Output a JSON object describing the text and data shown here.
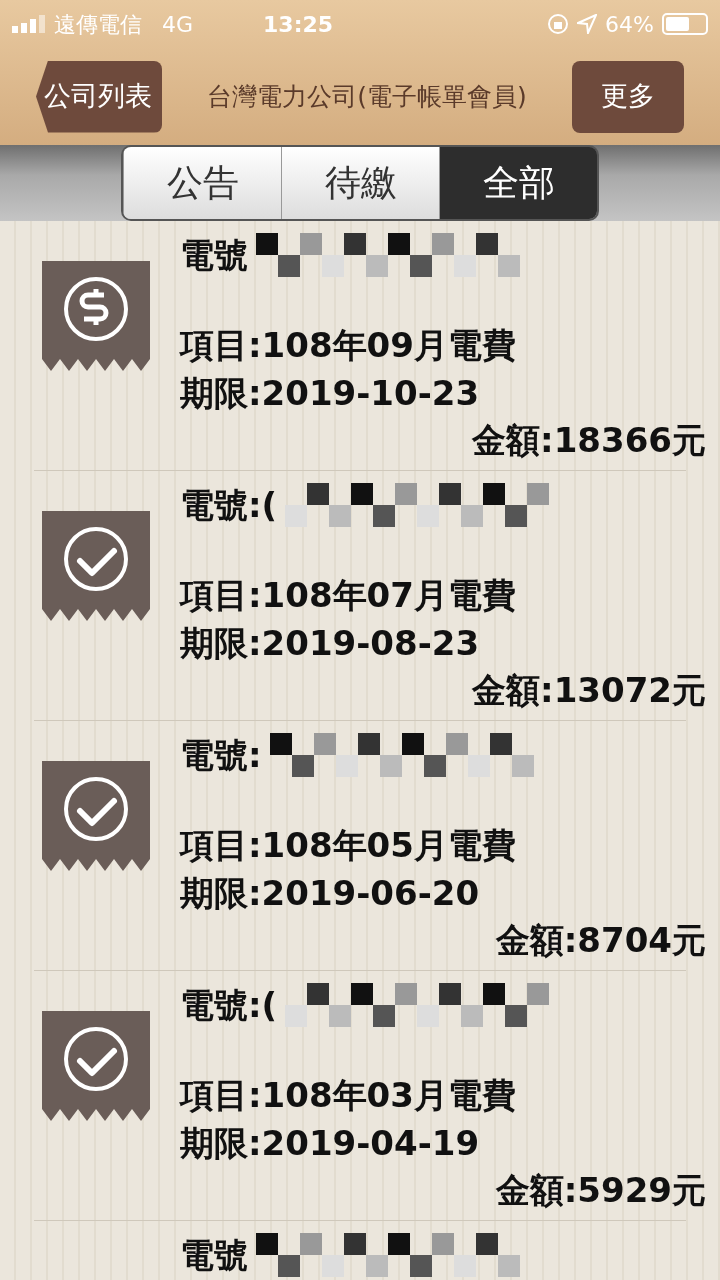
{
  "status_bar": {
    "carrier": "遠傳電信",
    "network": "4G",
    "time": "13:25",
    "battery": "64%"
  },
  "nav": {
    "back": "公司列表",
    "title": "台灣電力公司(電子帳單會員)",
    "more": "更多"
  },
  "tabs": [
    {
      "label": "公告",
      "selected": false
    },
    {
      "label": "待繳",
      "selected": false
    },
    {
      "label": "全部",
      "selected": true
    }
  ],
  "bills": [
    {
      "kind": "unpaid",
      "number": "電號",
      "item": "項目:108年09月電費",
      "due": "期限:2019-10-23",
      "amount": "金額:18366元"
    },
    {
      "kind": "paid",
      "number": "電號:(",
      "item": "項目:108年07月電費",
      "due": "期限:2019-08-23",
      "amount": "金額:13072元"
    },
    {
      "kind": "paid",
      "number": "電號:",
      "item": "項目:108年05月電費",
      "due": "期限:2019-06-20",
      "amount": "金額:8704元"
    },
    {
      "kind": "paid",
      "number": "電號:(",
      "item": "項目:108年03月電費",
      "due": "期限:2019-04-19",
      "amount": "金額:5929元"
    },
    {
      "kind": "partial",
      "number": "電號"
    }
  ]
}
